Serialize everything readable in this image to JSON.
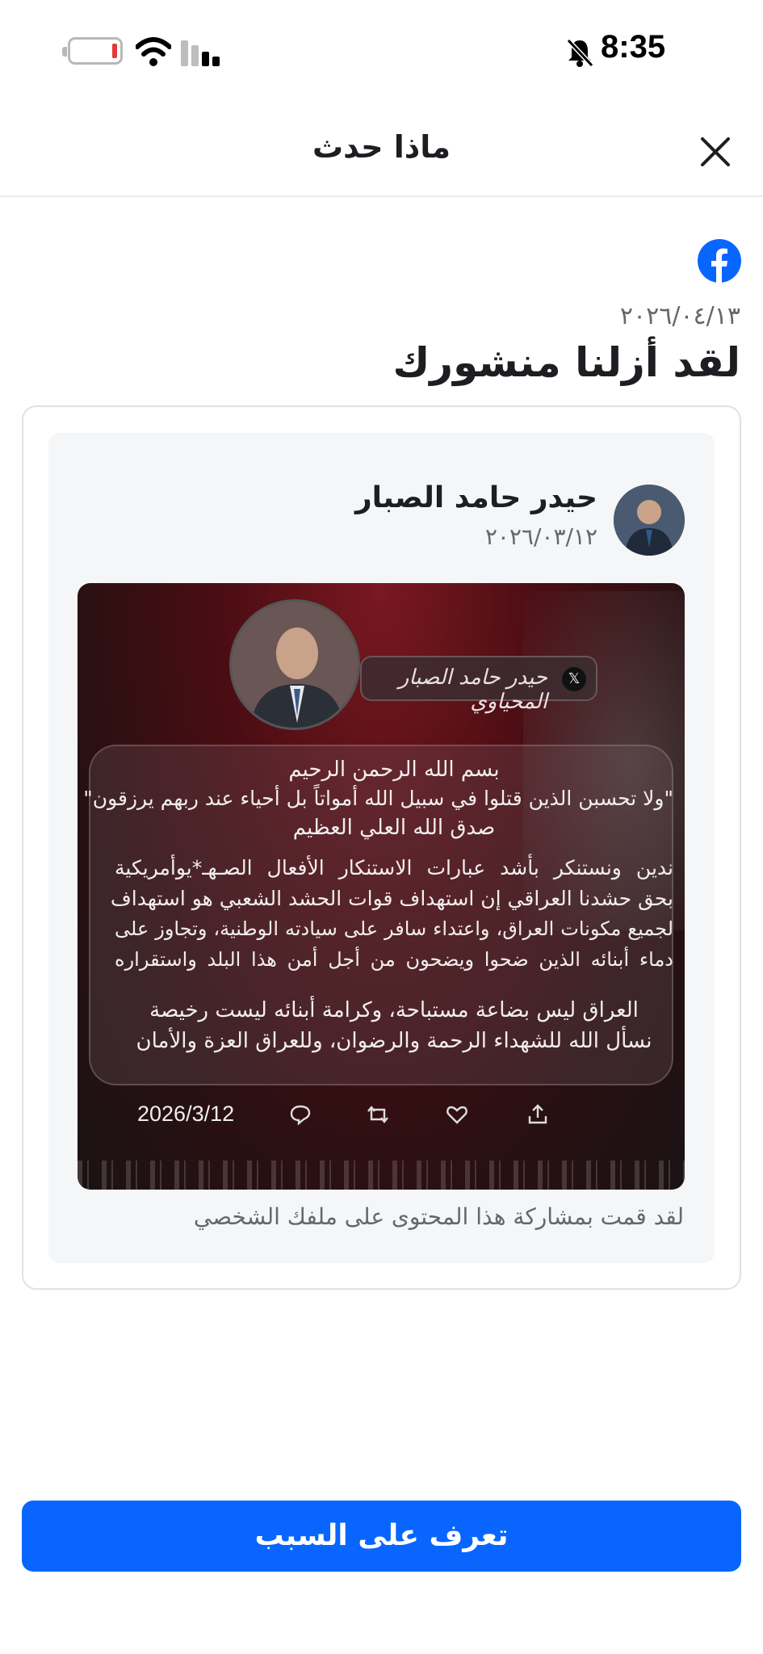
{
  "status_bar": {
    "time": "8:35"
  },
  "header": {
    "title": "ماذا حدث"
  },
  "notice": {
    "date": "٢٠٢٦/٠٤/١٣",
    "title": "لقد أزلنا منشورك"
  },
  "post": {
    "author_name": "حيدر حامد الصبار",
    "date": "٢٠٢٦/٠٣/١٢",
    "image": {
      "banner_name": "حيدر حامد الصبار المحياوي",
      "lines": [
        "بسم الله الرحمن الرحيم",
        "\"ولا تحسبن الذين قتلوا في سبيل الله أمواتاً بل أحياء عند ربهم يرزقون\"",
        "صدق الله العلي العظيم",
        "ندين ونستنكر بأشد عبارات الاستنكار الأفعال الصـهـ*يوأمريكية",
        "بحق حشدنا العراقي إن استهداف قوات الحشد الشعبي هو استهداف",
        "لجميع مكونات العراق، واعتداء سافر على سيادته الوطنية، وتجاوز على",
        "دماء أبنائه الذين ضحوا ويضحون من أجل أمن هذا البلد واستقراره",
        "العراق ليس بضاعة مستباحة، وكرامة أبنائه ليست رخيصة",
        "نسأل الله للشهداء الرحمة والرضوان، وللعراق العزة والأمان"
      ],
      "date": "2026/3/12"
    }
  },
  "share_note": "لقد قمت بمشاركة هذا المحتوى على ملفك الشخصي",
  "cta": {
    "label": "تعرف على السبب"
  },
  "colors": {
    "brand": "#0866ff",
    "accent_red": "#e53935"
  }
}
